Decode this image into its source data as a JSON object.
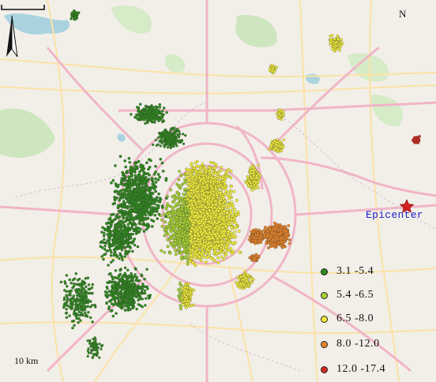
{
  "map": {
    "north_label": "N",
    "scale_label": "10 km",
    "epicenter_label": "Epicenter",
    "legend": [
      {
        "label": "3.1 -5.4",
        "color": "#2f8a1e"
      },
      {
        "label": "5.4 -6.5",
        "color": "#a6d233"
      },
      {
        "label": "6.5 -8.0",
        "color": "#f2ee3b"
      },
      {
        "label": "8.0 -12.0",
        "color": "#e8842a"
      },
      {
        "label": "12.0 -17.4",
        "color": "#d32a20"
      }
    ],
    "colors": {
      "land": "#f2efe9",
      "road_major": "#f0b5c7",
      "road_minor": "#fbe2a6",
      "water": "#aad3df",
      "park": "#cde6bf",
      "epicenter": "#d22020"
    }
  }
}
